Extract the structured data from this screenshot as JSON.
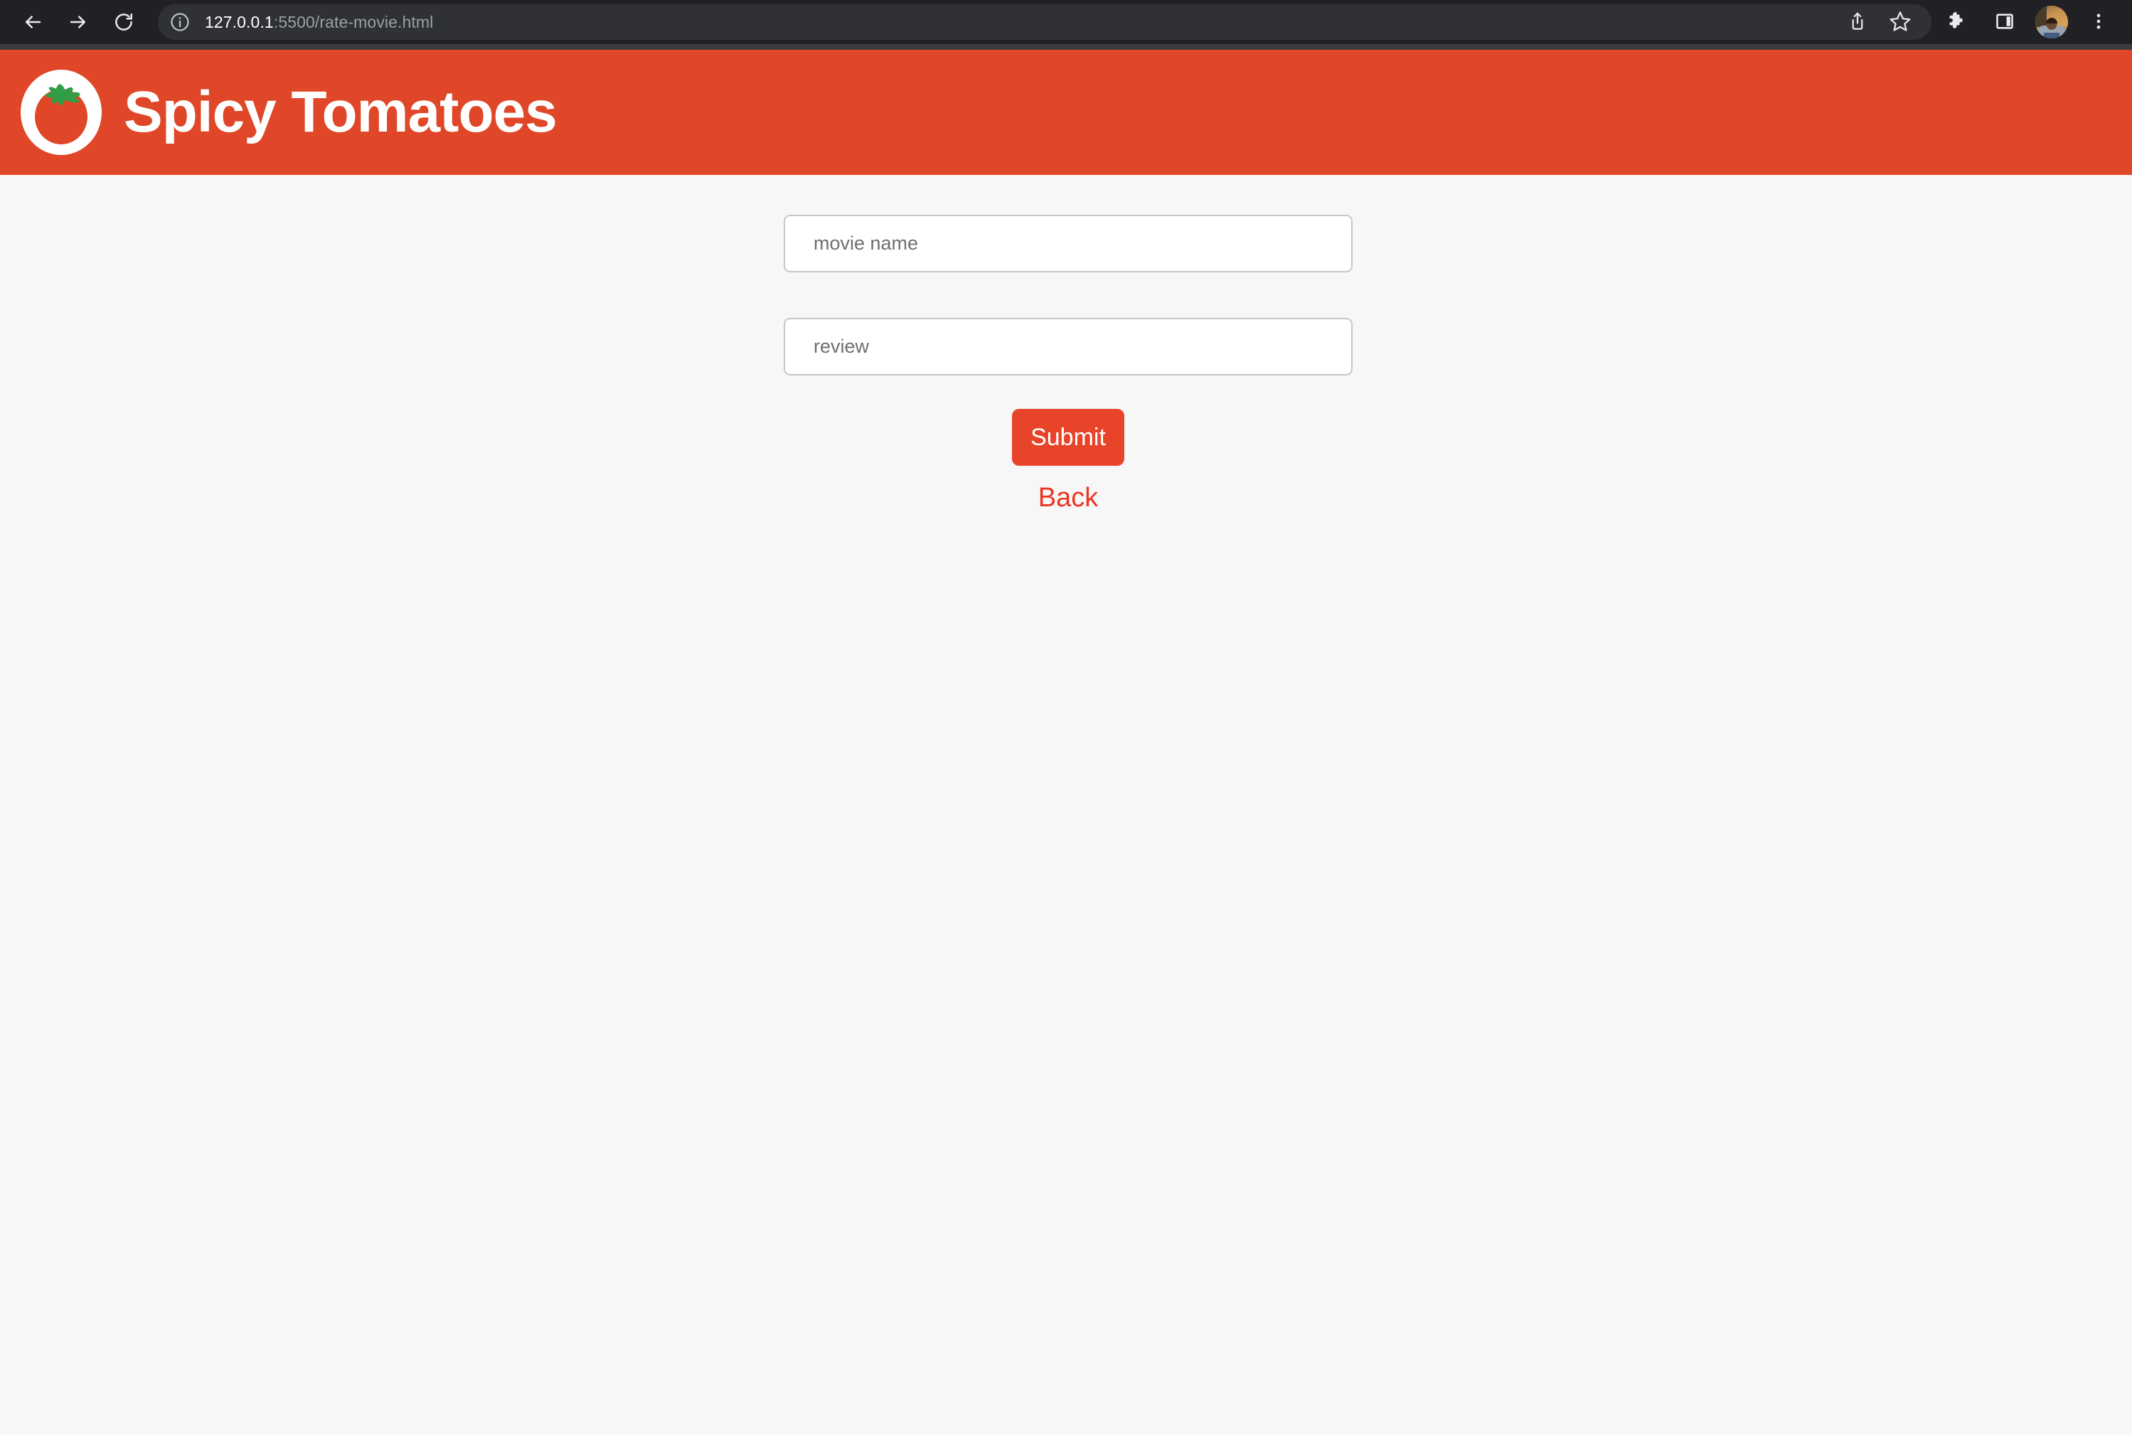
{
  "browser": {
    "back_icon": "arrow-left-icon",
    "forward_icon": "arrow-right-icon",
    "reload_icon": "reload-icon",
    "site_info_icon": "info-circle-icon",
    "url_host": "127.0.0.1",
    "url_path": ":5500/rate-movie.html",
    "url_full": "127.0.0.1:5500/rate-movie.html",
    "share_icon": "share-icon",
    "bookmark_icon": "star-icon",
    "extensions_icon": "puzzle-piece-icon",
    "sidebar_icon": "side-panel-icon",
    "avatar_label": "profile-avatar",
    "menu_icon": "three-dot-menu-icon",
    "colors": {
      "toolbar_bg": "#202124",
      "omnibox_bg": "#2f3134",
      "strip_bg": "#3a3c40",
      "url_host_color": "#ffffff",
      "url_path_color": "#9aa0a6"
    }
  },
  "header": {
    "brand": "Spicy Tomatoes",
    "logo_icon": "tomato-logo-icon",
    "bg_color": "#e04628",
    "text_color": "#ffffff",
    "tomato_color": "#e04628",
    "leaf_color": "#2f9e44",
    "ring_color": "#ffffff"
  },
  "form": {
    "movie_name": {
      "placeholder": "movie name",
      "value": ""
    },
    "review": {
      "placeholder": "review",
      "value": ""
    },
    "submit_label": "Submit",
    "submit_color": "#e8442a",
    "back_label": "Back",
    "back_color": "#ee3524"
  },
  "page": {
    "background": "#f7f7f7"
  }
}
